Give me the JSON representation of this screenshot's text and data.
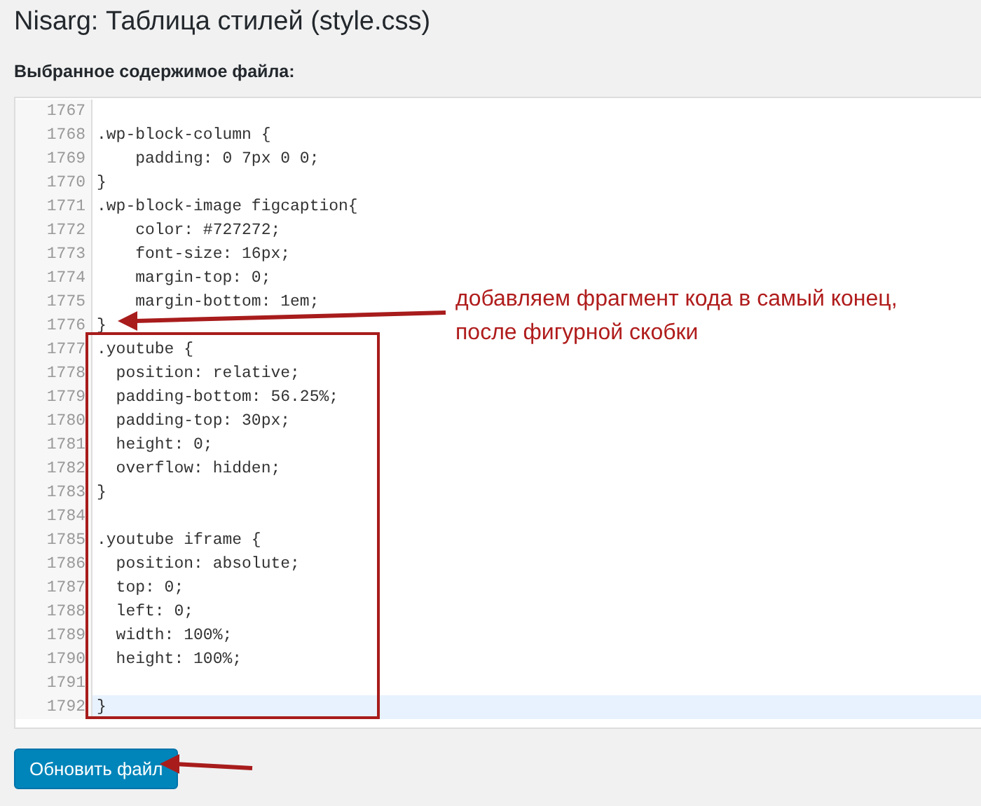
{
  "title": "Nisarg: Таблица стилей (style.css)",
  "subtitle": "Выбранное содержимое файла:",
  "editor": {
    "lines": [
      {
        "number": "1767",
        "current": false
      },
      {
        "number": "1768",
        "code": ".wp-block-column {",
        "current": false
      },
      {
        "number": "1769",
        "code": "    padding: 0 7px 0 0;",
        "current": false
      },
      {
        "number": "1770",
        "code": "}",
        "current": false
      },
      {
        "number": "1771",
        "code": ".wp-block-image figcaption{",
        "current": false
      },
      {
        "number": "1772",
        "code": "    color: #727272;",
        "current": false
      },
      {
        "number": "1773",
        "code": "    font-size: 16px;",
        "current": false
      },
      {
        "number": "1774",
        "code": "    margin-top: 0;",
        "current": false
      },
      {
        "number": "1775",
        "code": "    margin-bottom: 1em;",
        "current": false
      },
      {
        "number": "1776",
        "code": "}",
        "current": false
      },
      {
        "number": "1777",
        "code": ".youtube {",
        "current": false
      },
      {
        "number": "1778",
        "code": "  position: relative;",
        "current": false
      },
      {
        "number": "1779",
        "code": "  padding-bottom: 56.25%;",
        "current": false
      },
      {
        "number": "1780",
        "code": "  padding-top: 30px;",
        "current": false
      },
      {
        "number": "1781",
        "code": "  height: 0;",
        "current": false
      },
      {
        "number": "1782",
        "code": "  overflow: hidden;",
        "current": false
      },
      {
        "number": "1783",
        "code": "}",
        "current": false
      },
      {
        "number": "1784",
        "current": false
      },
      {
        "number": "1785",
        "code": ".youtube iframe {",
        "current": false
      },
      {
        "number": "1786",
        "code": "  position: absolute;",
        "current": false
      },
      {
        "number": "1787",
        "code": "  top: 0;",
        "current": false
      },
      {
        "number": "1788",
        "code": "  left: 0;",
        "current": false
      },
      {
        "number": "1789",
        "code": "  width: 100%;",
        "current": false
      },
      {
        "number": "1790",
        "code": "  height: 100%;",
        "current": false
      },
      {
        "number": "1791",
        "current": false
      },
      {
        "number": "1792",
        "code": "}",
        "current": true
      }
    ]
  },
  "annotation": {
    "text": "добавляем фрагмент кода в самый конец, после фигурной скобки"
  },
  "button": {
    "label": "Обновить файл"
  }
}
